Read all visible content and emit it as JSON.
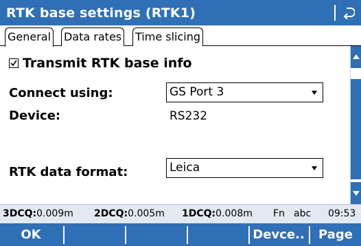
{
  "window": {
    "title": "RTK base settings (RTK1)",
    "back_icon": "back-return-icon"
  },
  "tabs": [
    {
      "label": "General",
      "active": true
    },
    {
      "label": "Data rates",
      "active": false
    },
    {
      "label": "Time slicing",
      "active": false
    }
  ],
  "general": {
    "transmit": {
      "label": "Transmit RTK base info",
      "checked": true,
      "check_glyph": "☑"
    },
    "connect_using": {
      "label": "Connect using:",
      "value": "GS Port 3"
    },
    "device": {
      "label": "Device:",
      "value": "RS232"
    },
    "rtk_data_format": {
      "label": "RTK data format:",
      "value": "Leica"
    }
  },
  "status": {
    "q3_label": "3DCQ:",
    "q3_value": "0.009m",
    "q2_label": "2DCQ:",
    "q2_value": "0.005m",
    "q1_label": "1DCQ:",
    "q1_value": "0.008m",
    "fn": "Fn",
    "input_mode": "abc",
    "time": "09:53"
  },
  "softkeys": {
    "f1": "OK",
    "f2": "",
    "f3": "",
    "f4": "",
    "f5": "Devce..",
    "f6": "Page"
  },
  "colors": {
    "accent": "#2f6fb6",
    "status_bg": "#e3e9f1"
  }
}
